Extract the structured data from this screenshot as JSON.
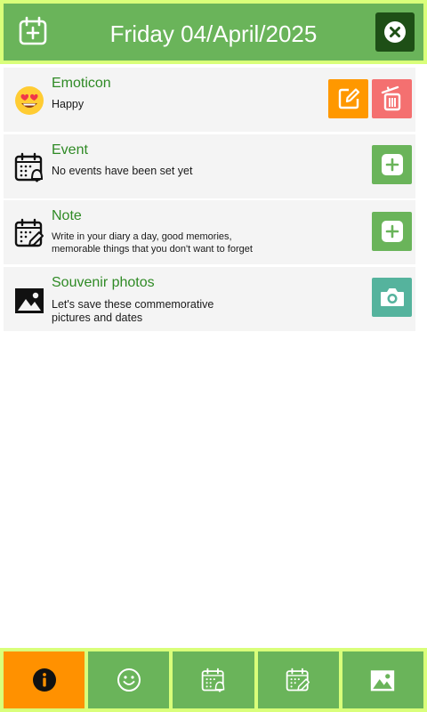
{
  "header": {
    "title": "Friday 04/April/2025",
    "add_icon": "calendar-plus-icon",
    "close_icon": "close-icon"
  },
  "cards": [
    {
      "title": "Emoticon",
      "description": "Happy",
      "icon": "heart-eyes-emoji-icon"
    },
    {
      "title": "Event",
      "description": "No events have been set yet",
      "icon": "calendar-bell-icon"
    },
    {
      "title": "Note",
      "description_line1": "Write in your diary a day, good memories,",
      "description_line2": "memorable things that you don't want to forget",
      "icon": "calendar-pencil-icon"
    },
    {
      "title": "Souvenir photos",
      "description_line1": "Let's save these commemorative",
      "description_line2": "pictures and dates",
      "icon": "image-icon"
    }
  ],
  "tabs": [
    {
      "icon": "info-icon",
      "active": true
    },
    {
      "icon": "smiley-icon",
      "active": false
    },
    {
      "icon": "calendar-bell-icon",
      "active": false
    },
    {
      "icon": "calendar-pencil-icon",
      "active": false
    },
    {
      "icon": "image-icon",
      "active": false
    }
  ],
  "colors": {
    "header_green": "#6ab45a",
    "header_border": "#d9ff7a",
    "title_green": "#2f8a25",
    "edit_orange": "#ff9800",
    "delete_red": "#f47070",
    "camera_teal": "#55b39d",
    "active_tab_orange": "#ff9100"
  }
}
